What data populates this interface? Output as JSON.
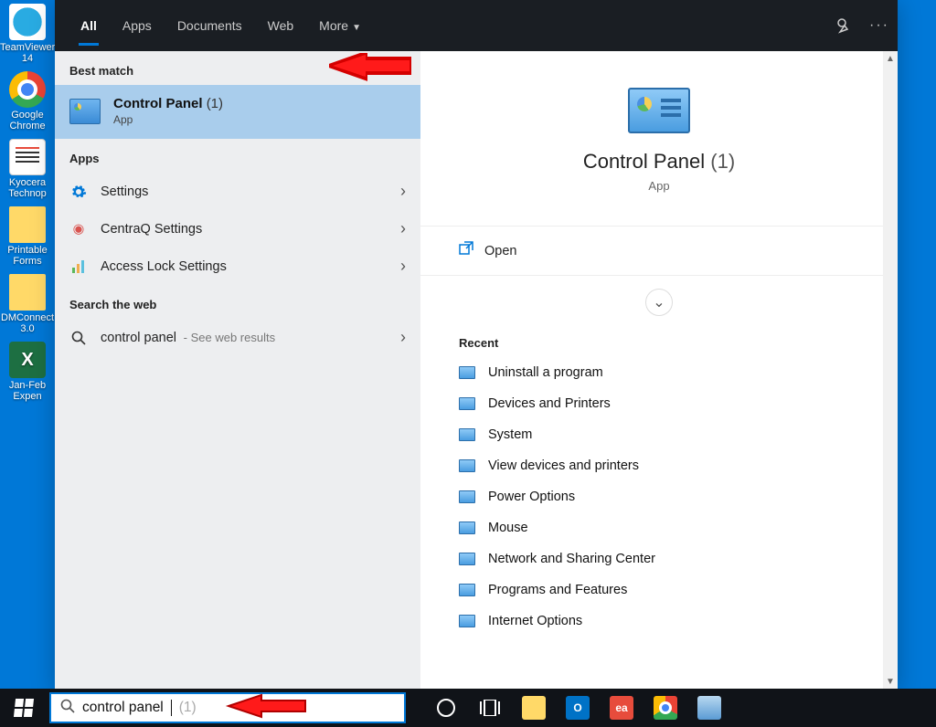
{
  "topbar": {
    "tabs": [
      {
        "label": "All",
        "active": true
      },
      {
        "label": "Apps",
        "active": false
      },
      {
        "label": "Documents",
        "active": false
      },
      {
        "label": "Web",
        "active": false
      },
      {
        "label": "More",
        "active": false,
        "has_caret": true
      }
    ]
  },
  "left": {
    "best_match_heading": "Best match",
    "best_match": {
      "title": "Control Panel",
      "count": "(1)",
      "subtitle": "App"
    },
    "apps_heading": "Apps",
    "apps": [
      {
        "icon": "gear-icon",
        "label": "Settings"
      },
      {
        "icon": "hub-icon",
        "label": "CentraQ Settings"
      },
      {
        "icon": "chart-icon",
        "label": "Access Lock Settings"
      }
    ],
    "web_heading": "Search the web",
    "web_item": {
      "query": "control panel",
      "suffix": " - See web results"
    }
  },
  "right": {
    "title": "Control Panel",
    "count": "(1)",
    "subtitle": "App",
    "open_label": "Open",
    "recent_heading": "Recent",
    "recent": [
      "Uninstall a program",
      "Devices and Printers",
      "System",
      "View devices and printers",
      "Power Options",
      "Mouse",
      "Network and Sharing Center",
      "Programs and Features",
      "Internet Options"
    ]
  },
  "desktop": [
    {
      "label": "TeamViewer 14",
      "type": "tv"
    },
    {
      "label": "Google Chrome",
      "type": "chrome"
    },
    {
      "label": "Kyocera Technop",
      "type": "doc"
    },
    {
      "label": "Printable Forms",
      "type": "folder"
    },
    {
      "label": "DMConnect 3.0",
      "type": "folder"
    },
    {
      "label": "Jan-Feb Expen",
      "type": "excel"
    }
  ],
  "taskbar": {
    "search_text": "control panel",
    "search_count": "(1)"
  }
}
